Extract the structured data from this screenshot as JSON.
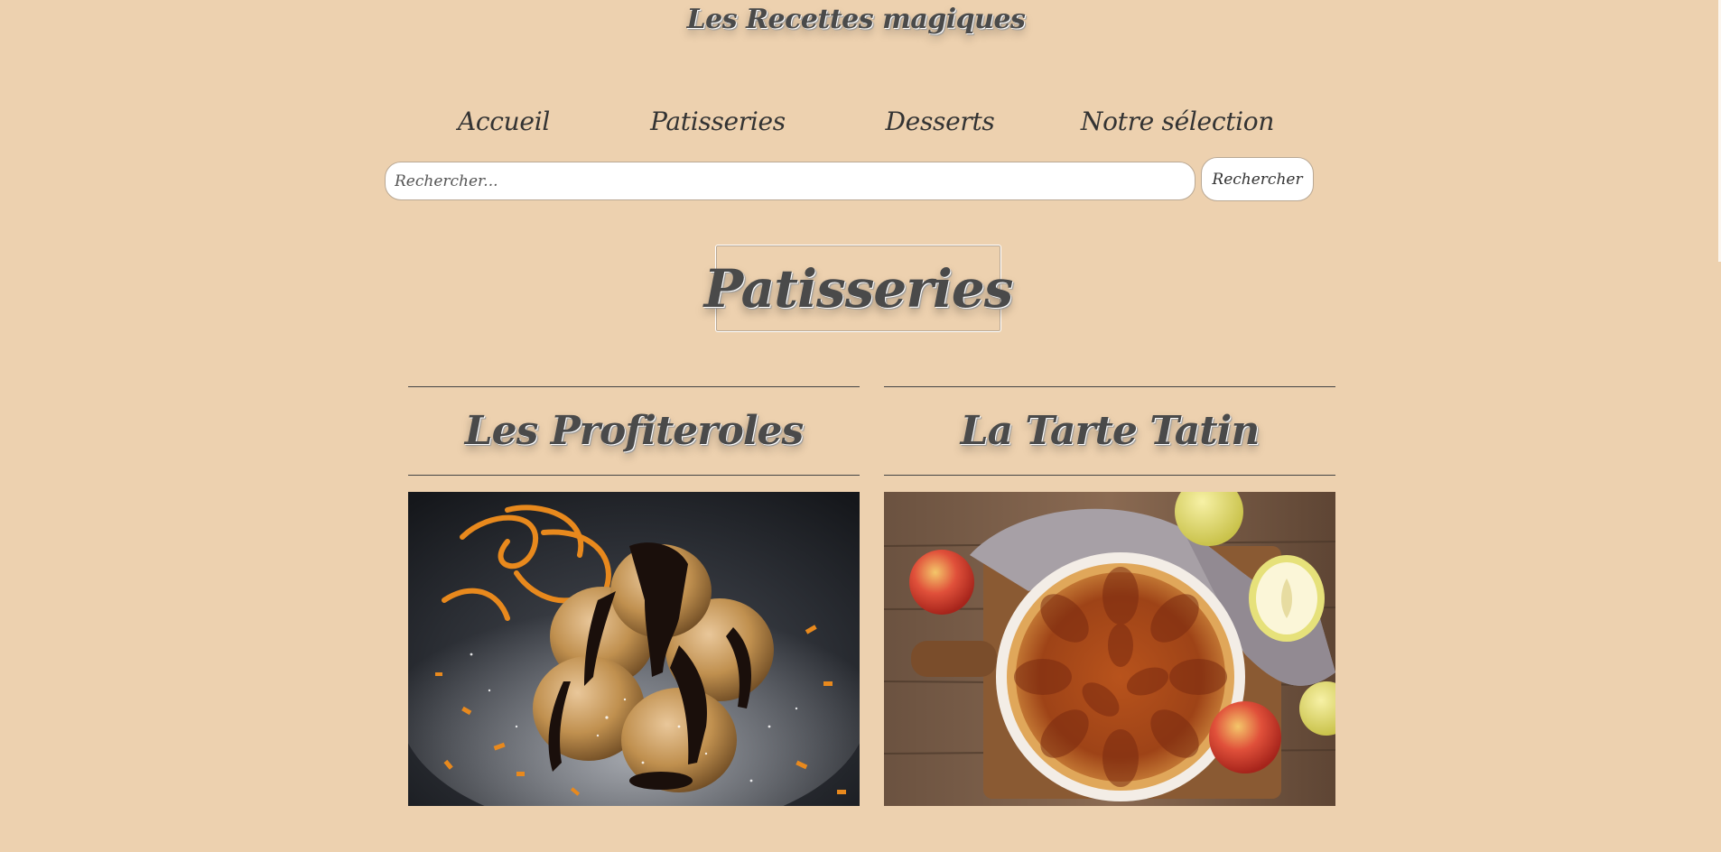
{
  "header": {
    "site_title": "Les Recettes magiques"
  },
  "nav": {
    "items": [
      {
        "label": "Accueil"
      },
      {
        "label": "Patisseries"
      },
      {
        "label": "Desserts"
      },
      {
        "label": "Notre sélection"
      }
    ]
  },
  "search": {
    "placeholder": "Rechercher...",
    "value": "",
    "button_label": "Rechercher"
  },
  "main": {
    "page_heading": "Patisseries",
    "recipes": [
      {
        "title": "Les Profiteroles",
        "image": "profiteroles-photo"
      },
      {
        "title": "La Tarte Tatin",
        "image": "tarte-tatin-photo"
      }
    ]
  },
  "colors": {
    "background": "#edd1af",
    "text": "#3a3a3a",
    "input_background": "#ffffff"
  }
}
